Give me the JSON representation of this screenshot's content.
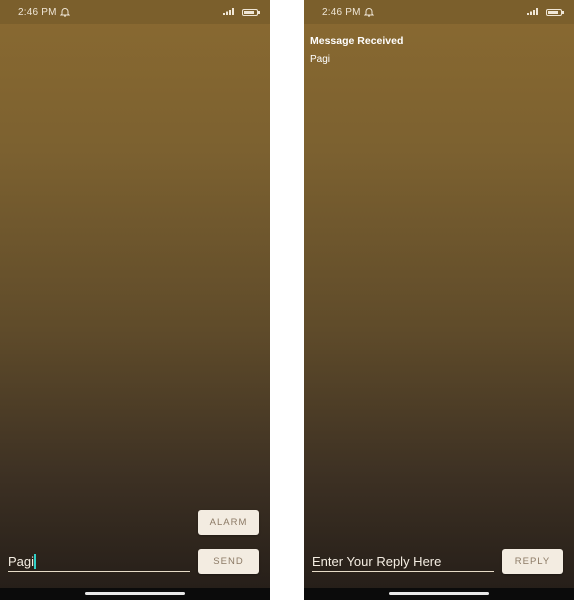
{
  "status_bar": {
    "time": "2:46 PM"
  },
  "left_screen": {
    "alarm_label": "ALARM",
    "send_label": "SEND",
    "message_input_value": "Pagi"
  },
  "right_screen": {
    "title": "Message Received",
    "message": "Pagi",
    "reply_placeholder": "Enter Your Reply Here",
    "reply_label": "REPLY"
  },
  "icons": [
    "bell-icon",
    "signal-icon",
    "battery-icon"
  ],
  "colors": {
    "status_bar_bg": "#7b5f2c",
    "button_bg": "#f3ece1",
    "button_text": "#8c7a65",
    "caret": "#30d0c8"
  }
}
